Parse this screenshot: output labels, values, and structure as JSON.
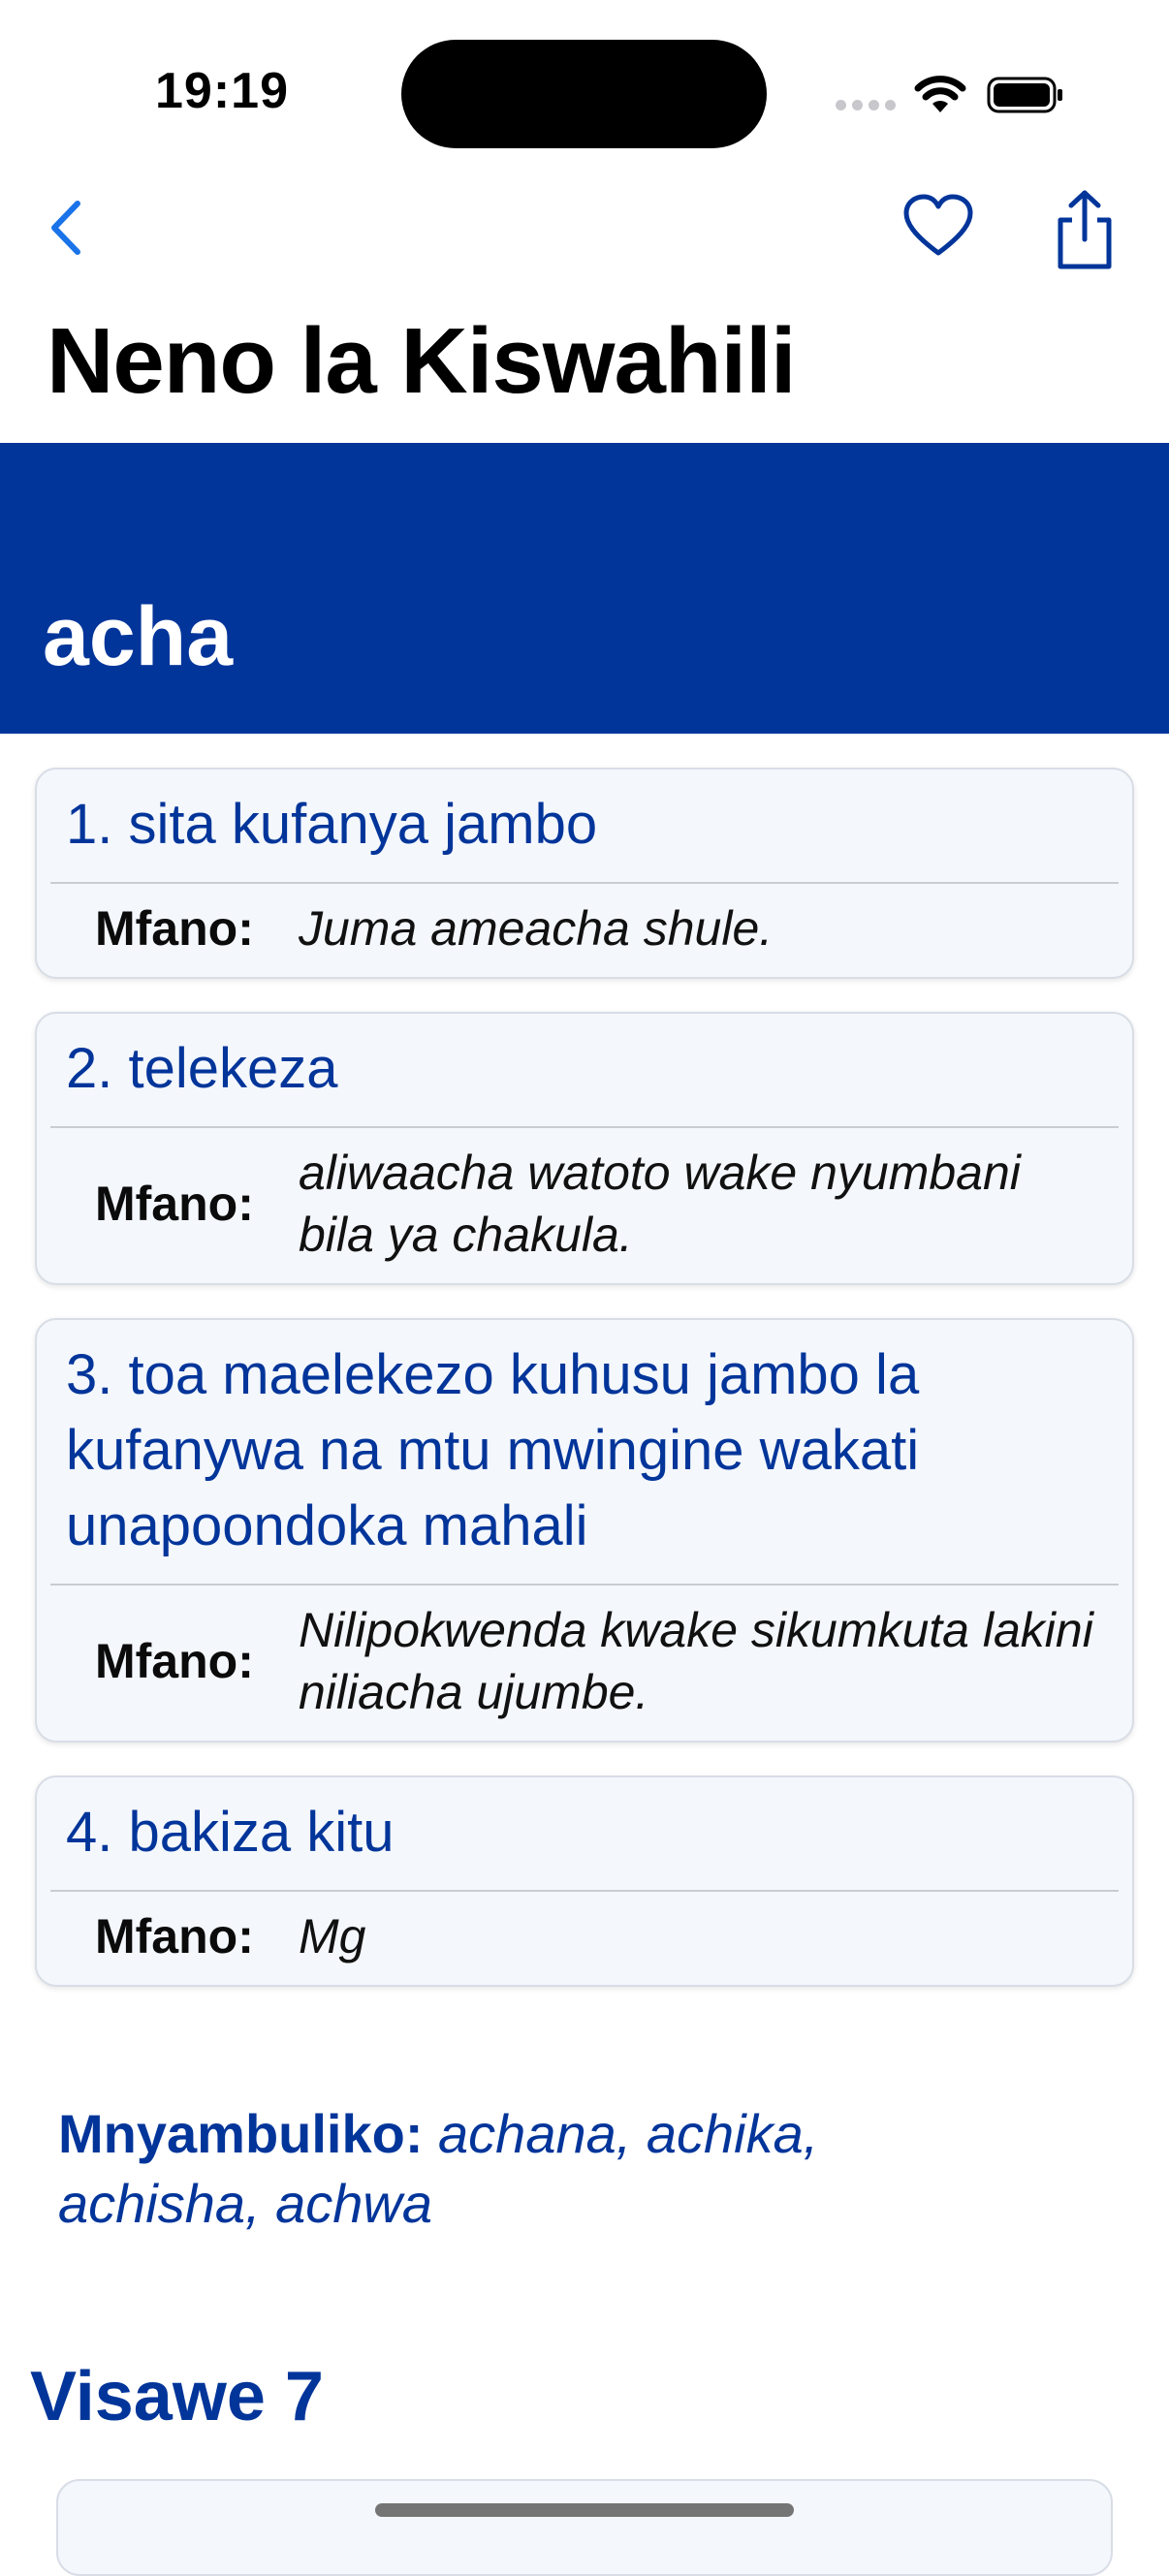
{
  "status_bar": {
    "time": "19:19"
  },
  "nav": {
    "title": "Neno la Kiswahili"
  },
  "word": {
    "headword": "acha"
  },
  "senses": [
    {
      "definition": "1. sita kufanya jambo",
      "example_label": "Mfano:",
      "example": "Juma ameacha shule."
    },
    {
      "definition": "2. telekeza",
      "example_label": "Mfano:",
      "example": "aliwaacha watoto wake nyumbani bila ya chakula."
    },
    {
      "definition": "3. toa maelekezo kuhusu jambo la kufanywa na mtu mwingine wakati unapoondoka mahali",
      "example_label": "Mfano:",
      "example": "Nilipokwenda kwake sikumkuta lakini niliacha ujumbe."
    },
    {
      "definition": "4. bakiza kitu",
      "example_label": "Mfano:",
      "example": "Mg"
    }
  ],
  "derivatives": {
    "label": "Mnyambuliko:",
    "values": "achana, achika, achisha, achwa"
  },
  "synonyms": {
    "title": "Visawe 7"
  },
  "colors": {
    "accent": "#02359a",
    "link": "#1a73e8",
    "card_bg": "#f4f7fc"
  },
  "icons": {
    "back": "chevron-left-icon",
    "favorite": "heart-icon",
    "share": "share-icon"
  }
}
